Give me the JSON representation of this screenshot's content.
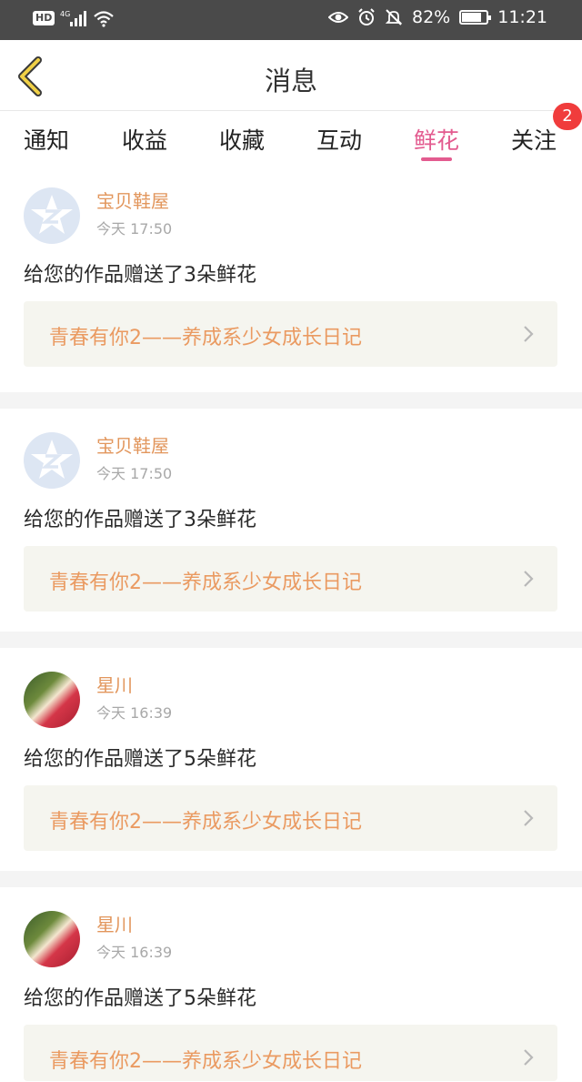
{
  "status_bar": {
    "hd": "HD",
    "network": "4G",
    "battery_percent": "82%",
    "battery_level": 0.82,
    "time": "11:21",
    "icons": [
      "signal-icon",
      "wifi-icon",
      "eye-icon",
      "alarm-icon",
      "mute-bell-icon",
      "battery-icon"
    ]
  },
  "header": {
    "title": "消息",
    "back_icon": "chevron-left-icon"
  },
  "tabs": [
    {
      "label": "通知"
    },
    {
      "label": "收益"
    },
    {
      "label": "收藏"
    },
    {
      "label": "互动"
    },
    {
      "label": "鲜花",
      "active": true
    },
    {
      "label": "关注",
      "badge": "2"
    }
  ],
  "accent_color": "#e35b8f",
  "messages": [
    {
      "username": "宝贝鞋屋",
      "time": "今天 17:50",
      "text": "给您的作品赠送了3朵鲜花",
      "card_title": "青春有你2——养成系少女成长日记",
      "avatar": "default-avatar"
    },
    {
      "username": "宝贝鞋屋",
      "time": "今天 17:50",
      "text": "给您的作品赠送了3朵鲜花",
      "card_title": "青春有你2——养成系少女成长日记",
      "avatar": "default-avatar"
    },
    {
      "username": "星川",
      "time": "今天 16:39",
      "text": "给您的作品赠送了5朵鲜花",
      "card_title": "青春有你2——养成系少女成长日记",
      "avatar": "photo-avatar"
    },
    {
      "username": "星川",
      "time": "今天 16:39",
      "text": "给您的作品赠送了5朵鲜花",
      "card_title": "青春有你2——养成系少女成长日记",
      "avatar": "photo-avatar"
    }
  ]
}
